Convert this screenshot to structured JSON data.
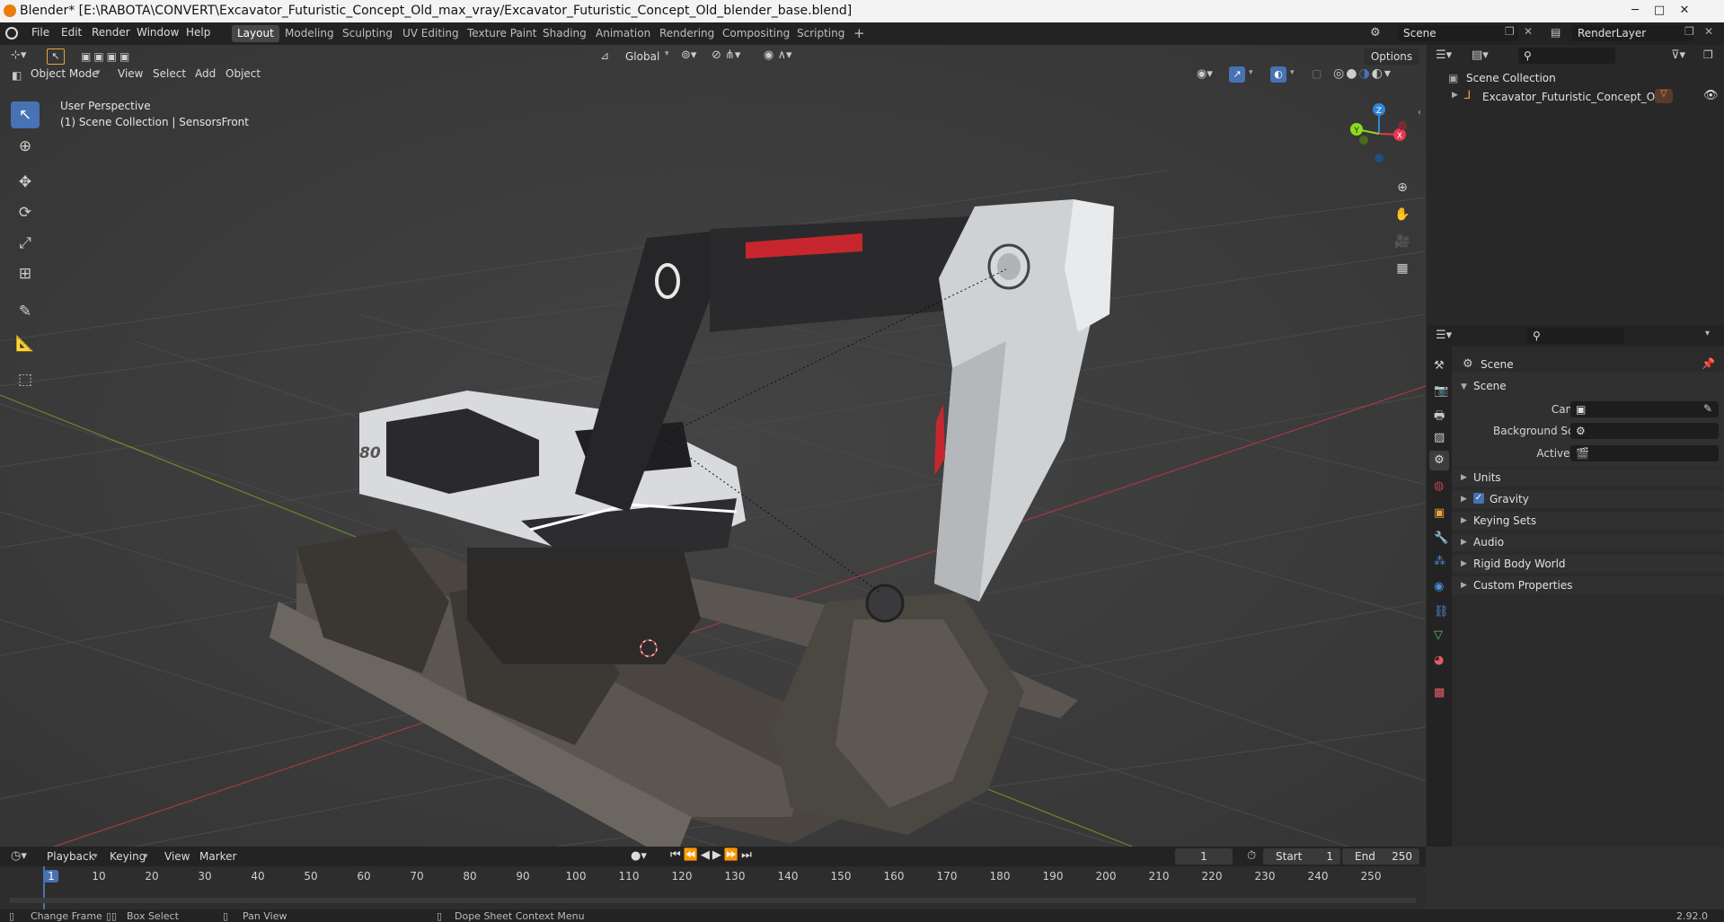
{
  "window": {
    "title": "Blender* [E:\\RABOTA\\CONVERT\\Excavator_Futuristic_Concept_Old_max_vray/Excavator_Futuristic_Concept_Old_blender_base.blend]",
    "minimize": "─",
    "maximize": "□",
    "close": "✕"
  },
  "menu": [
    "File",
    "Edit",
    "Render",
    "Window",
    "Help"
  ],
  "workspaces": [
    "Layout",
    "Modeling",
    "Sculpting",
    "UV Editing",
    "Texture Paint",
    "Shading",
    "Animation",
    "Rendering",
    "Compositing",
    "Scripting"
  ],
  "active_workspace": "Layout",
  "add_workspace": "+",
  "scene_field": "Scene",
  "view_layer_field": "RenderLayer",
  "viewport": {
    "transform_orientation": "Global",
    "options_label": "Options",
    "mode": "Object Mode",
    "menus": [
      "View",
      "Select",
      "Add",
      "Object"
    ],
    "info_line1": "User Perspective",
    "info_line2": "(1) Scene Collection | SensorsFront",
    "gizmo": {
      "z": "Z",
      "y": "Y",
      "x": "X"
    },
    "object_badge": "80"
  },
  "outliner": {
    "root": "Scene Collection",
    "item": "Excavator_Futuristic_Concept_Old"
  },
  "properties": {
    "context": "Scene",
    "panel": "Scene",
    "camera_label": "Camera",
    "background_scene_label": "Background Scene",
    "active_clip_label": "Active Clip",
    "sections": [
      "Units",
      "Gravity",
      "Keying Sets",
      "Audio",
      "Rigid Body World",
      "Custom Properties"
    ],
    "gravity_checked": true
  },
  "timeline": {
    "menus": [
      "Playback",
      "Keying",
      "View",
      "Marker"
    ],
    "current_frame": "1",
    "start_label": "Start",
    "start_value": "1",
    "end_label": "End",
    "end_value": "250",
    "ticks": [
      "1",
      "10",
      "20",
      "30",
      "40",
      "50",
      "60",
      "70",
      "80",
      "90",
      "100",
      "110",
      "120",
      "130",
      "140",
      "150",
      "160",
      "170",
      "180",
      "190",
      "200",
      "210",
      "220",
      "230",
      "240",
      "250"
    ]
  },
  "statusbar": {
    "hint1": "Change Frame",
    "hint2": "Box Select",
    "hint3": "Pan View",
    "hint4": "Dope Sheet Context Menu",
    "version": "2.92.0"
  },
  "colors": {
    "accent": "#4772b3",
    "axis_x": "#e8374f",
    "axis_y": "#8bdc21",
    "axis_z": "#2f86d8",
    "blender_orange": "#e87d0d"
  }
}
